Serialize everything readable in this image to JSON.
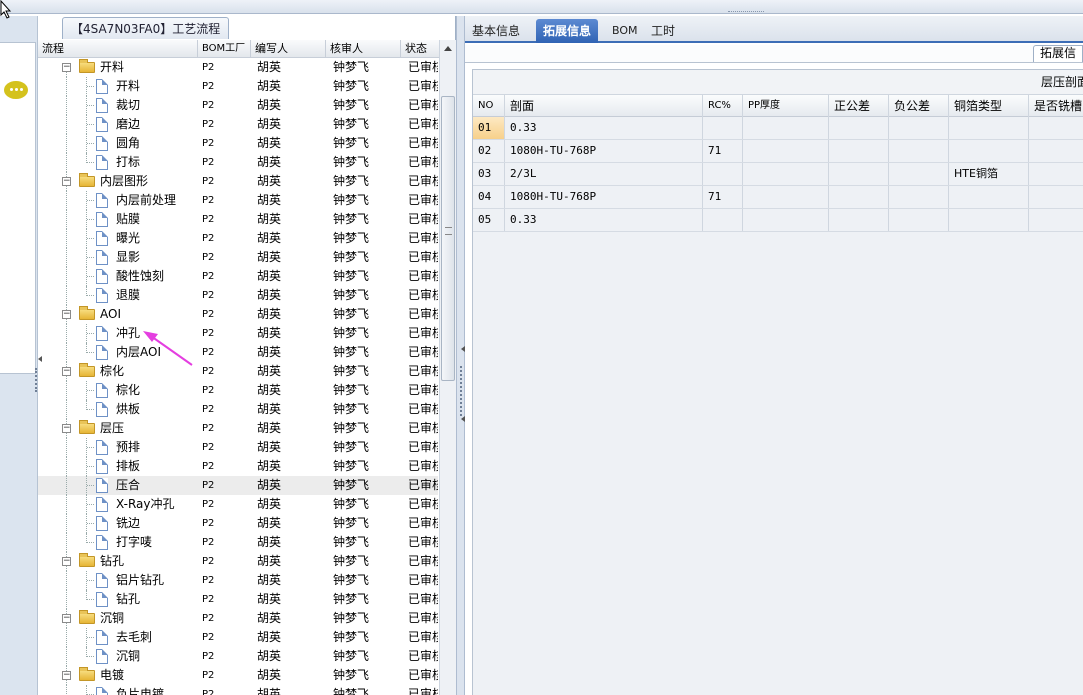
{
  "left_panel": {
    "tab_title": "【4SA7N03FA0】工艺流程",
    "columns": [
      "流程",
      "BOM工厂",
      "编写人",
      "核审人",
      "状态"
    ],
    "rows": [
      {
        "label": "开料",
        "type": "folder",
        "level": 1,
        "bom": "P2",
        "writer": "胡英",
        "reviewer": "钟梦飞",
        "status": "已审核"
      },
      {
        "label": "开料",
        "type": "doc",
        "level": 2,
        "bom": "P2",
        "writer": "胡英",
        "reviewer": "钟梦飞",
        "status": "已审核"
      },
      {
        "label": "裁切",
        "type": "doc",
        "level": 2,
        "bom": "P2",
        "writer": "胡英",
        "reviewer": "钟梦飞",
        "status": "已审核"
      },
      {
        "label": "磨边",
        "type": "doc",
        "level": 2,
        "bom": "P2",
        "writer": "胡英",
        "reviewer": "钟梦飞",
        "status": "已审核"
      },
      {
        "label": "圆角",
        "type": "doc",
        "level": 2,
        "bom": "P2",
        "writer": "胡英",
        "reviewer": "钟梦飞",
        "status": "已审核"
      },
      {
        "label": "打标",
        "type": "doc",
        "level": 2,
        "bom": "P2",
        "writer": "胡英",
        "reviewer": "钟梦飞",
        "status": "已审核"
      },
      {
        "label": "内层图形",
        "type": "folder",
        "level": 1,
        "bom": "P2",
        "writer": "胡英",
        "reviewer": "钟梦飞",
        "status": "已审核"
      },
      {
        "label": "内层前处理",
        "type": "doc",
        "level": 2,
        "bom": "P2",
        "writer": "胡英",
        "reviewer": "钟梦飞",
        "status": "已审核"
      },
      {
        "label": "贴膜",
        "type": "doc",
        "level": 2,
        "bom": "P2",
        "writer": "胡英",
        "reviewer": "钟梦飞",
        "status": "已审核"
      },
      {
        "label": "曝光",
        "type": "doc",
        "level": 2,
        "bom": "P2",
        "writer": "胡英",
        "reviewer": "钟梦飞",
        "status": "已审核"
      },
      {
        "label": "显影",
        "type": "doc",
        "level": 2,
        "bom": "P2",
        "writer": "胡英",
        "reviewer": "钟梦飞",
        "status": "已审核"
      },
      {
        "label": "酸性蚀刻",
        "type": "doc",
        "level": 2,
        "bom": "P2",
        "writer": "胡英",
        "reviewer": "钟梦飞",
        "status": "已审核"
      },
      {
        "label": "退膜",
        "type": "doc",
        "level": 2,
        "bom": "P2",
        "writer": "胡英",
        "reviewer": "钟梦飞",
        "status": "已审核"
      },
      {
        "label": "AOI",
        "type": "folder",
        "level": 1,
        "bom": "P2",
        "writer": "胡英",
        "reviewer": "钟梦飞",
        "status": "已审核"
      },
      {
        "label": "冲孔",
        "type": "doc",
        "level": 2,
        "bom": "P2",
        "writer": "胡英",
        "reviewer": "钟梦飞",
        "status": "已审核"
      },
      {
        "label": "内层AOI",
        "type": "doc",
        "level": 2,
        "bom": "P2",
        "writer": "胡英",
        "reviewer": "钟梦飞",
        "status": "已审核"
      },
      {
        "label": "棕化",
        "type": "folder",
        "level": 1,
        "bom": "P2",
        "writer": "胡英",
        "reviewer": "钟梦飞",
        "status": "已审核"
      },
      {
        "label": "棕化",
        "type": "doc",
        "level": 2,
        "bom": "P2",
        "writer": "胡英",
        "reviewer": "钟梦飞",
        "status": "已审核"
      },
      {
        "label": "烘板",
        "type": "doc",
        "level": 2,
        "bom": "P2",
        "writer": "胡英",
        "reviewer": "钟梦飞",
        "status": "已审核"
      },
      {
        "label": "层压",
        "type": "folder",
        "level": 1,
        "bom": "P2",
        "writer": "胡英",
        "reviewer": "钟梦飞",
        "status": "已审核"
      },
      {
        "label": "预排",
        "type": "doc",
        "level": 2,
        "bom": "P2",
        "writer": "胡英",
        "reviewer": "钟梦飞",
        "status": "已审核"
      },
      {
        "label": "排板",
        "type": "doc",
        "level": 2,
        "bom": "P2",
        "writer": "胡英",
        "reviewer": "钟梦飞",
        "status": "已审核"
      },
      {
        "label": "压合",
        "type": "doc",
        "level": 2,
        "bom": "P2",
        "writer": "胡英",
        "reviewer": "钟梦飞",
        "status": "已审核",
        "selected": true
      },
      {
        "label": "X-Ray冲孔",
        "type": "doc",
        "level": 2,
        "bom": "P2",
        "writer": "胡英",
        "reviewer": "钟梦飞",
        "status": "已审核"
      },
      {
        "label": "铣边",
        "type": "doc",
        "level": 2,
        "bom": "P2",
        "writer": "胡英",
        "reviewer": "钟梦飞",
        "status": "已审核"
      },
      {
        "label": "打字唛",
        "type": "doc",
        "level": 2,
        "bom": "P2",
        "writer": "胡英",
        "reviewer": "钟梦飞",
        "status": "已审核"
      },
      {
        "label": "钻孔",
        "type": "folder",
        "level": 1,
        "bom": "P2",
        "writer": "胡英",
        "reviewer": "钟梦飞",
        "status": "已审核"
      },
      {
        "label": "铝片钻孔",
        "type": "doc",
        "level": 2,
        "bom": "P2",
        "writer": "胡英",
        "reviewer": "钟梦飞",
        "status": "已审核"
      },
      {
        "label": "钻孔",
        "type": "doc",
        "level": 2,
        "bom": "P2",
        "writer": "胡英",
        "reviewer": "钟梦飞",
        "status": "已审核"
      },
      {
        "label": "沉铜",
        "type": "folder",
        "level": 1,
        "bom": "P2",
        "writer": "胡英",
        "reviewer": "钟梦飞",
        "status": "已审核"
      },
      {
        "label": "去毛刺",
        "type": "doc",
        "level": 2,
        "bom": "P2",
        "writer": "胡英",
        "reviewer": "钟梦飞",
        "status": "已审核"
      },
      {
        "label": "沉铜",
        "type": "doc",
        "level": 2,
        "bom": "P2",
        "writer": "胡英",
        "reviewer": "钟梦飞",
        "status": "已审核"
      },
      {
        "label": "电镀",
        "type": "folder",
        "level": 1,
        "bom": "P2",
        "writer": "胡英",
        "reviewer": "钟梦飞",
        "status": "已审核"
      },
      {
        "label": "负片电镀",
        "type": "doc",
        "level": 2,
        "bom": "P2",
        "writer": "胡英",
        "reviewer": "钟梦飞",
        "status": "已审核"
      }
    ]
  },
  "right_panel": {
    "tabs": [
      {
        "label": "基本信息",
        "active": false
      },
      {
        "label": "拓展信息",
        "active": true
      },
      {
        "label": "BOM",
        "active": false
      },
      {
        "label": "工时",
        "active": false
      }
    ],
    "sub_tab": "拓展信",
    "grid_title": "层压剖面",
    "columns": [
      "NO",
      "剖面",
      "RC%",
      "PP厚度",
      "正公差",
      "负公差",
      "铜箔类型",
      "是否铣槽"
    ],
    "rows": [
      {
        "no": "01",
        "section": "0.33",
        "rc": "",
        "pp": "",
        "pos": "",
        "neg": "",
        "foil": "",
        "slot": ""
      },
      {
        "no": "02",
        "section": "1080H-TU-768P",
        "rc": "71",
        "pp": "",
        "pos": "",
        "neg": "",
        "foil": "",
        "slot": ""
      },
      {
        "no": "03",
        "section": "2/3L",
        "rc": "",
        "pp": "",
        "pos": "",
        "neg": "",
        "foil": "HTE铜箔",
        "slot": ""
      },
      {
        "no": "04",
        "section": "1080H-TU-768P",
        "rc": "71",
        "pp": "",
        "pos": "",
        "neg": "",
        "foil": "",
        "slot": ""
      },
      {
        "no": "05",
        "section": "0.33",
        "rc": "",
        "pp": "",
        "pos": "",
        "neg": "",
        "foil": "",
        "slot": ""
      }
    ]
  },
  "colors": {
    "accent": "#3c6db6",
    "annotation_arrow": "#e43ee0",
    "folder": "#e6b536"
  },
  "icons": [
    "chat-bubble-icon",
    "folder-icon",
    "document-icon",
    "collapse-toggle-icon",
    "sort-up-icon"
  ]
}
